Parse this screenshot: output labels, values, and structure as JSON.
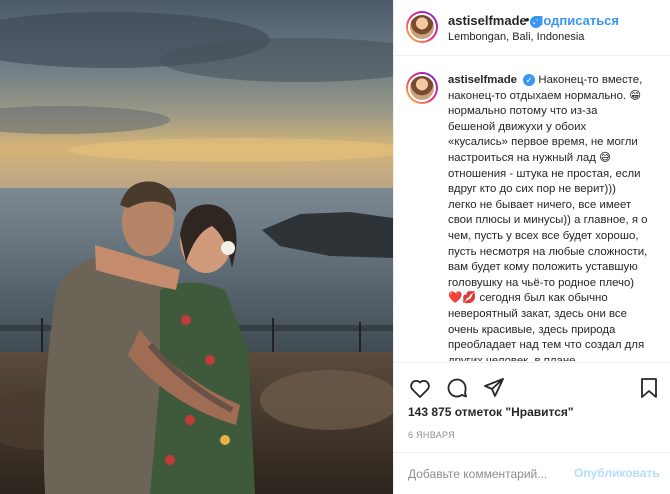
{
  "header": {
    "username": "astiselfmade",
    "separator": "•",
    "follow_label": "Подписаться",
    "location": "Lembongan, Bali, Indonesia"
  },
  "caption": {
    "username": "astiselfmade",
    "text": "Наконец-то вместе,\nнаконец-то отдыхаем нормально. 😁\nнормально потому что из-за\nбешеной движухи у обоих\n«кусались» первое время, не могли\nнастроиться на нужный лад 😅\nотношения - штука не простая, если\nвдруг кто до сих пор не верит)))\nлегко не бывает ничего, все имеет\nсвои плюсы и минусы)) а главное, я о\nчем, пусть у всех все будет хорошо,\nпусть несмотря на любые сложности,\nвам будет кому положить уставшую\nголовушку на чьё-то родное плечо)\n❤️💋 сегодня был как обычно\nневероятный закат, здесь они все\nочень красивые, здесь природа\nпреобладает над тем что создал для\nдругих человек, в плане"
  },
  "icons": {
    "like": "heart-icon",
    "comment": "comment-icon",
    "share": "share-icon",
    "save": "bookmark-icon",
    "verified": "verified-badge-icon"
  },
  "stats": {
    "likes": "143 875 отметок \"Нравится\""
  },
  "date": "6 ЯНВАРЯ",
  "comment": {
    "placeholder": "Добавьте комментарий...",
    "post_label": "Опубликовать"
  },
  "colors": {
    "accent": "#3897f0",
    "disabled_post": "#b2dffc",
    "muted": "#8e8e8e",
    "text": "#262626"
  }
}
